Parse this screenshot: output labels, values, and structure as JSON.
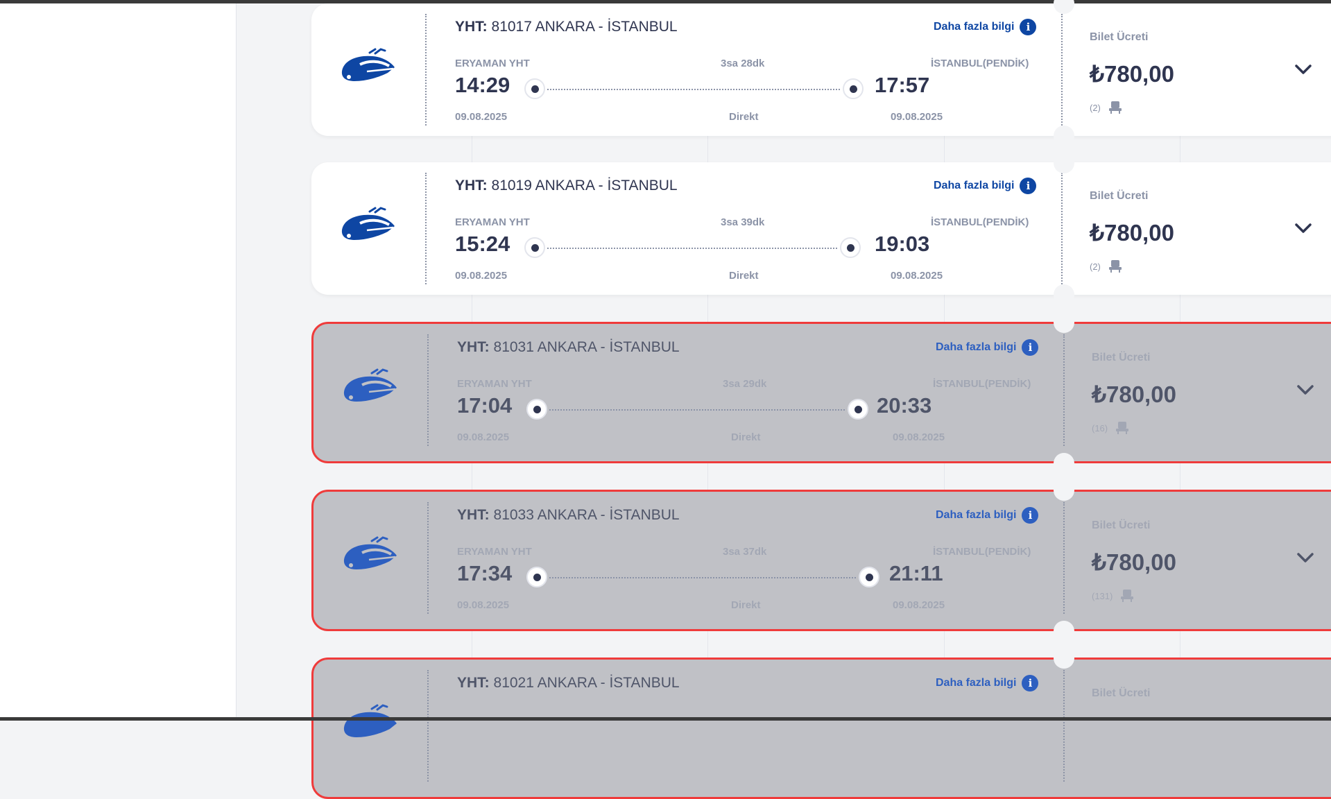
{
  "colors": {
    "accent": "#0e46a3",
    "text": "#2f3550",
    "muted": "#8b93a7",
    "highlight": "#ef3b3b"
  },
  "trips": [
    {
      "label": "YHT:",
      "number": "81017 ANKARA - İSTANBUL",
      "more": "Daha fazla bilgi",
      "info_icon": "i",
      "from": "ERYAMAN YHT",
      "to": "İSTANBUL(PENDİK)",
      "duration": "3sa 28dk",
      "dep_time": "14:29",
      "arr_time": "17:57",
      "dep_date": "09.08.2025",
      "arr_date": "09.08.2025",
      "direct": "Direkt",
      "price_label": "Bilet Ücreti",
      "price": "₺780,00",
      "seats": "(2)",
      "available": true
    },
    {
      "label": "YHT:",
      "number": "81019 ANKARA - İSTANBUL",
      "more": "Daha fazla bilgi",
      "info_icon": "i",
      "from": "ERYAMAN YHT",
      "to": "İSTANBUL(PENDİK)",
      "duration": "3sa 39dk",
      "dep_time": "15:24",
      "arr_time": "19:03",
      "dep_date": "09.08.2025",
      "arr_date": "09.08.2025",
      "direct": "Direkt",
      "price_label": "Bilet Ücreti",
      "price": "₺780,00",
      "seats": "(2)",
      "available": true
    },
    {
      "label": "YHT:",
      "number": "81031 ANKARA - İSTANBUL",
      "more": "Daha fazla bilgi",
      "info_icon": "i",
      "from": "ERYAMAN YHT",
      "to": "İSTANBUL(PENDİK)",
      "duration": "3sa 29dk",
      "dep_time": "17:04",
      "arr_time": "20:33",
      "dep_date": "09.08.2025",
      "arr_date": "09.08.2025",
      "direct": "Direkt",
      "price_label": "Bilet Ücreti",
      "price": "₺780,00",
      "seats": "(16)",
      "available": false
    },
    {
      "label": "YHT:",
      "number": "81033 ANKARA - İSTANBUL",
      "more": "Daha fazla bilgi",
      "info_icon": "i",
      "from": "ERYAMAN YHT",
      "to": "İSTANBUL(PENDİK)",
      "duration": "3sa 37dk",
      "dep_time": "17:34",
      "arr_time": "21:11",
      "dep_date": "09.08.2025",
      "arr_date": "09.08.2025",
      "direct": "Direkt",
      "price_label": "Bilet Ücreti",
      "price": "₺780,00",
      "seats": "(131)",
      "available": false
    },
    {
      "label": "YHT:",
      "number": "81021 ANKARA - İSTANBUL",
      "more": "Daha fazla bilgi",
      "info_icon": "i",
      "price_label": "Bilet Ücreti",
      "available": false
    }
  ]
}
